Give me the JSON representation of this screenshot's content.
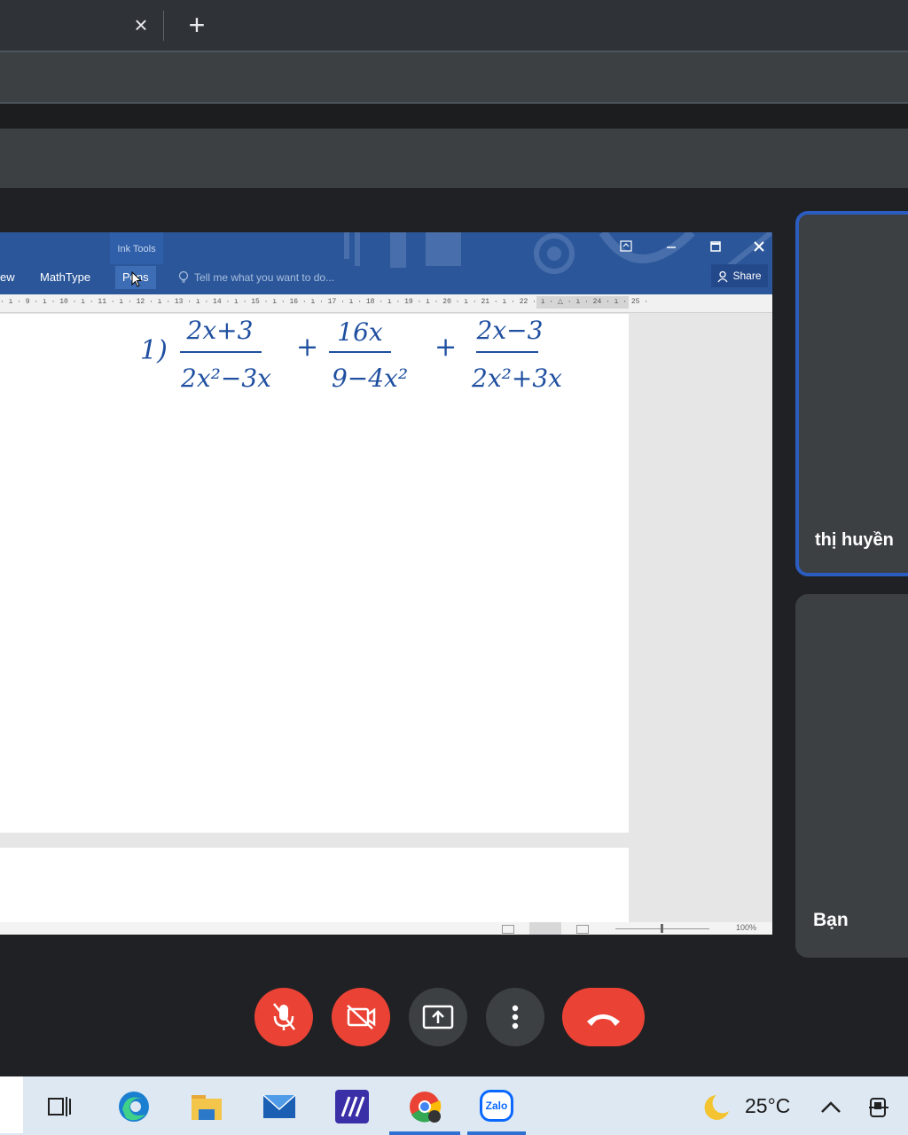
{
  "browser": {
    "tab_close_glyph": "×",
    "new_tab_glyph": "+"
  },
  "word": {
    "ribbon_context_title": "Ink Tools",
    "tabs": [
      "ew",
      "MathType",
      "Pens"
    ],
    "tell_me_placeholder": "Tell me what you want to do...",
    "share_label": "Share",
    "ruler_text": "· ı · 9 · ı · 10 · ı · 11 · ı · 12 · ı · 13 · ı · 14 · ı · 15 · ı · 16 · ı · 17 · ı · 18 · ı · 19 · ı · 20 · ı · 21 · ı · 22 · ı · △ · ı · 24 · ı · 25 ·",
    "zoom_level": "100%",
    "handwriting": {
      "item_number": "1)",
      "fractions": [
        {
          "numerator": "2x+3",
          "denominator": "2x²−3x"
        },
        {
          "numerator": "16x",
          "denominator": "9−4x²"
        },
        {
          "numerator": "2x−3",
          "denominator": "2x²+3x"
        }
      ],
      "operators": [
        "+",
        "+"
      ]
    }
  },
  "participants": [
    {
      "name": "thị huyền",
      "active_speaker": true
    },
    {
      "name": "Bạn",
      "active_speaker": false
    }
  ],
  "controls": {
    "mic": {
      "icon": "mic-off-icon",
      "state": "off",
      "color": "#ea4335"
    },
    "camera": {
      "icon": "camera-off-icon",
      "state": "off",
      "color": "#ea4335"
    },
    "present": {
      "icon": "present-screen-icon"
    },
    "more": {
      "icon": "more-vertical-icon"
    },
    "hangup": {
      "icon": "hang-up-icon",
      "color": "#ea4335"
    }
  },
  "taskbar": {
    "apps": [
      "task-view-icon",
      "edge-icon",
      "file-explorer-icon",
      "mail-icon",
      "mathtype-icon",
      "chrome-icon",
      "zalo-icon"
    ],
    "zalo_label": "Zalo",
    "temperature": "25°C"
  }
}
